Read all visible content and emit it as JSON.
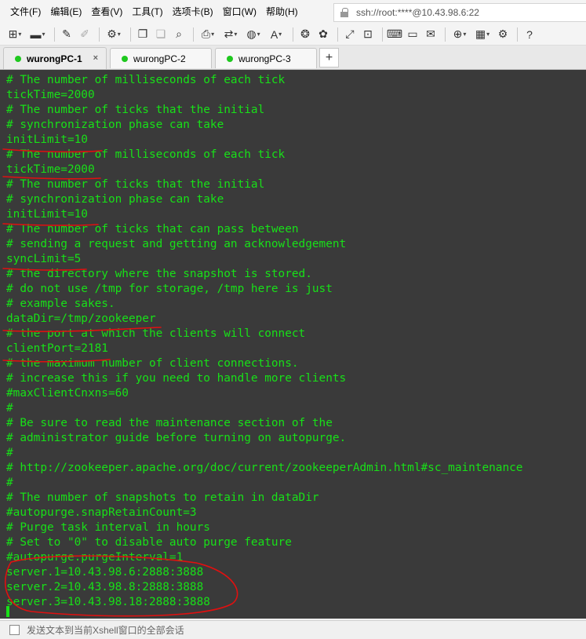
{
  "menu": [
    "文件(F)",
    "编辑(E)",
    "查看(V)",
    "工具(T)",
    "选项卡(B)",
    "窗口(W)",
    "帮助(H)"
  ],
  "address": "ssh://root:****@10.43.98.6:22",
  "toolbar_icons": [
    "new-session-icon",
    "open-folder-icon",
    "edit-icon",
    "pen-icon",
    "properties-icon",
    "copy-icon",
    "paste-icon",
    "find-icon",
    "print-icon",
    "transfer-icon",
    "globe-icon",
    "font-icon",
    "xftp-icon",
    "xmanager-icon",
    "fullscreen-icon",
    "lock-icon",
    "keyboard-icon",
    "script-icon",
    "compose-icon",
    "add-icon",
    "layout-icon",
    "settings-icon",
    "help-icon"
  ],
  "tabs": [
    {
      "label": "wurongPC-1",
      "close": "×"
    },
    {
      "label": "wurongPC-2"
    },
    {
      "label": "wurongPC-3"
    }
  ],
  "tab_add": "+",
  "terminal_lines": [
    "# The number of milliseconds of each tick",
    "tickTime=2000",
    "# The number of ticks that the initial",
    "# synchronization phase can take",
    "initLimit=10",
    "# The number of milliseconds of each tick",
    "tickTime=2000",
    "# The number of ticks that the initial",
    "# synchronization phase can take",
    "initLimit=10",
    "# The number of ticks that can pass between",
    "# sending a request and getting an acknowledgement",
    "syncLimit=5",
    "# the directory where the snapshot is stored.",
    "# do not use /tmp for storage, /tmp here is just",
    "# example sakes.",
    "dataDir=/tmp/zookeeper",
    "# the port at which the clients will connect",
    "clientPort=2181",
    "# the maximum number of client connections.",
    "# increase this if you need to handle more clients",
    "#maxClientCnxns=60",
    "#",
    "# Be sure to read the maintenance section of the",
    "# administrator guide before turning on autopurge.",
    "#",
    "# http://zookeeper.apache.org/doc/current/zookeeperAdmin.html#sc_maintenance",
    "#",
    "# The number of snapshots to retain in dataDir",
    "#autopurge.snapRetainCount=3",
    "# Purge task interval in hours",
    "# Set to \"0\" to disable auto purge feature",
    "#autopurge.purgeInterval=1",
    "server.1=10.43.98.6:2888:3888",
    "server.2=10.43.98.8:2888:3888",
    "server.3=10.43.98.18:2888:3888"
  ],
  "status_text": "发送文本到当前Xshell窗口的全部会话"
}
